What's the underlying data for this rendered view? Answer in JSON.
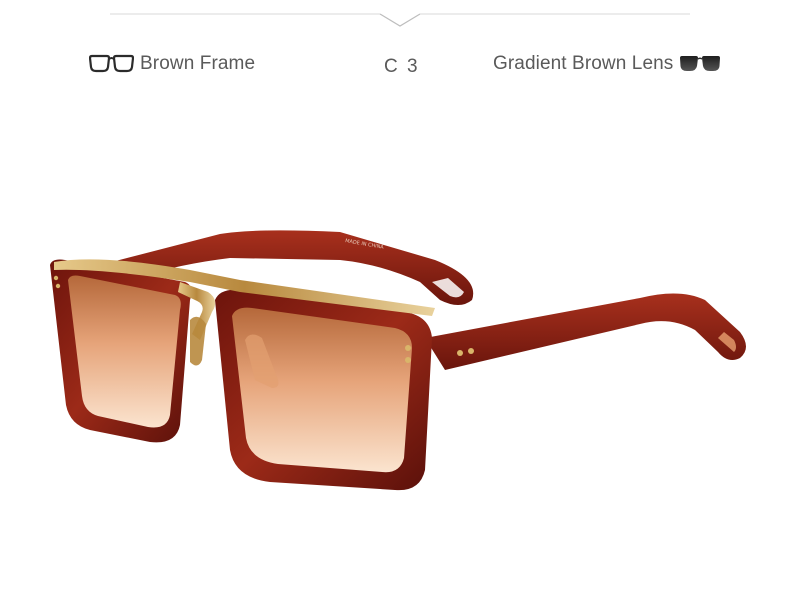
{
  "specs": {
    "frame_label": "Brown Frame",
    "color_code": "C 3",
    "lens_label": "Gradient Brown Lens"
  },
  "photo": {
    "subject": "sunglasses",
    "temple_imprint": "MADE IN CHINA"
  },
  "colors": {
    "text": "#5a5a5a",
    "divider": "#d9d9d9",
    "frame_brown": "#8a1c12",
    "frame_highlight": "#b8402c",
    "gold": "#c9a25a",
    "lens_top": "#b5683a",
    "lens_bottom": "#fbe4cf",
    "icon_dark": "#2b2b2b"
  }
}
